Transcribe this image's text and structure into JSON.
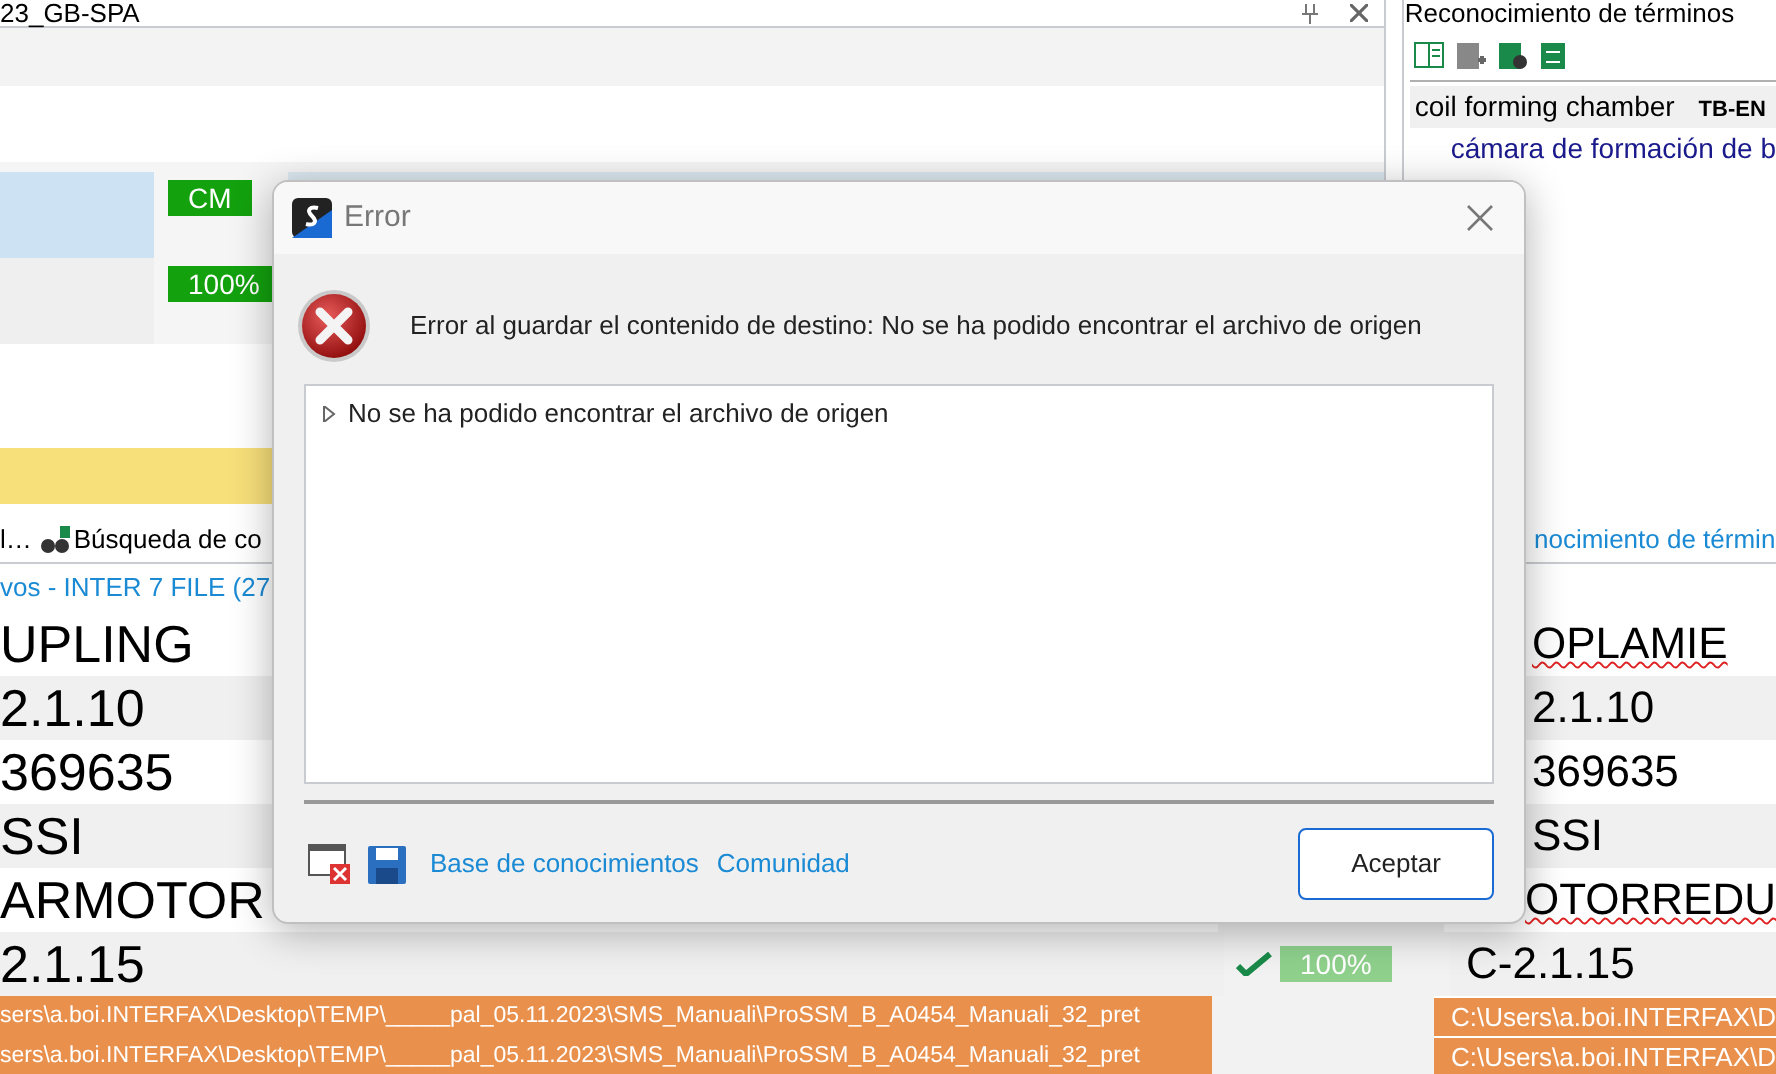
{
  "editor": {
    "title": "23_GB-SPA",
    "rows": [
      {
        "status": "CM",
        "selected": true
      },
      {
        "status": "100%",
        "selected": false
      }
    ]
  },
  "term_panel": {
    "title": "Reconocimiento de términos",
    "entries": [
      {
        "source": "coil forming chamber",
        "termbase": "TB-EN",
        "target": "cámara de formación de b"
      }
    ]
  },
  "bottom_tabs": [
    {
      "label": "l…",
      "kind": "text"
    },
    {
      "label": "Búsqueda de co",
      "kind": "search"
    }
  ],
  "term_tab": {
    "label": "nocimiento de términ"
  },
  "file_header": "vos - INTER 7 FILE (27",
  "segments": [
    {
      "source": "UPLING",
      "target": "OPLAMIE",
      "misspelled": true
    },
    {
      "source": "2.1.10",
      "target": "2.1.10",
      "misspelled": false
    },
    {
      "source": "369635",
      "target": "369635",
      "misspelled": false
    },
    {
      "source": "SSI",
      "target": "SSI",
      "misspelled": false
    },
    {
      "source": "ARMOTOR",
      "target": "OTORREDU",
      "misspelled": true
    },
    {
      "source": "2.1.15",
      "target": "C-2.1.15",
      "misspelled": false,
      "status": "100%"
    }
  ],
  "paths": [
    {
      "source": "sers\\a.boi.INTERFAX\\Desktop\\TEMP\\_____pal_05.11.2023\\SMS_Manuali\\ProSSM_B_A0454_Manuali_32_pret",
      "target": "C:\\Users\\a.boi.INTERFAX\\D"
    },
    {
      "source": "sers\\a.boi.INTERFAX\\Desktop\\TEMP\\_____pal_05.11.2023\\SMS_Manuali\\ProSSM_B_A0454_Manuali_32_pret",
      "target": "C:\\Users\\a.boi.INTERFAX\\D"
    }
  ],
  "dialog": {
    "title": "Error",
    "message": "Error al guardar el contenido de destino: No se ha podido encontrar el archivo de origen",
    "details": [
      {
        "text": "No se ha podido encontrar el archivo de origen",
        "expanded": false
      }
    ],
    "links": [
      "Base de conocimientos",
      "Comunidad"
    ],
    "button": "Aceptar"
  }
}
